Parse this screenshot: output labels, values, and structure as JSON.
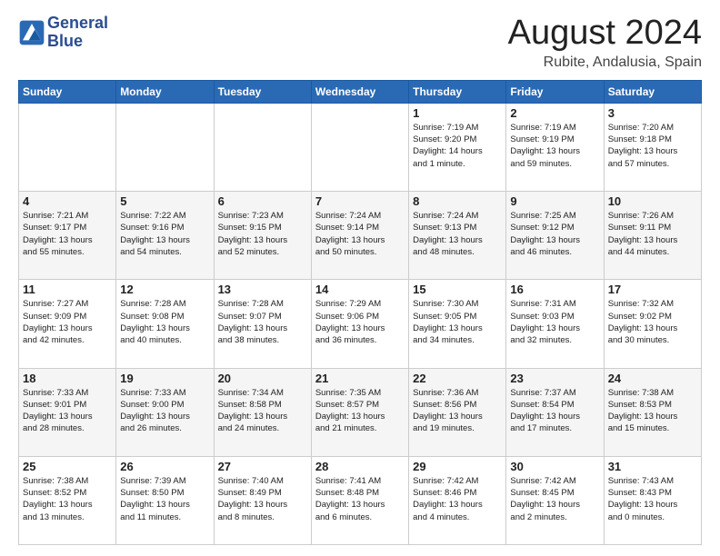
{
  "logo": {
    "line1": "General",
    "line2": "Blue"
  },
  "title": "August 2024",
  "location": "Rubite, Andalusia, Spain",
  "header_days": [
    "Sunday",
    "Monday",
    "Tuesday",
    "Wednesday",
    "Thursday",
    "Friday",
    "Saturday"
  ],
  "weeks": [
    [
      {
        "day": "",
        "info": ""
      },
      {
        "day": "",
        "info": ""
      },
      {
        "day": "",
        "info": ""
      },
      {
        "day": "",
        "info": ""
      },
      {
        "day": "1",
        "info": "Sunrise: 7:19 AM\nSunset: 9:20 PM\nDaylight: 14 hours\nand 1 minute."
      },
      {
        "day": "2",
        "info": "Sunrise: 7:19 AM\nSunset: 9:19 PM\nDaylight: 13 hours\nand 59 minutes."
      },
      {
        "day": "3",
        "info": "Sunrise: 7:20 AM\nSunset: 9:18 PM\nDaylight: 13 hours\nand 57 minutes."
      }
    ],
    [
      {
        "day": "4",
        "info": "Sunrise: 7:21 AM\nSunset: 9:17 PM\nDaylight: 13 hours\nand 55 minutes."
      },
      {
        "day": "5",
        "info": "Sunrise: 7:22 AM\nSunset: 9:16 PM\nDaylight: 13 hours\nand 54 minutes."
      },
      {
        "day": "6",
        "info": "Sunrise: 7:23 AM\nSunset: 9:15 PM\nDaylight: 13 hours\nand 52 minutes."
      },
      {
        "day": "7",
        "info": "Sunrise: 7:24 AM\nSunset: 9:14 PM\nDaylight: 13 hours\nand 50 minutes."
      },
      {
        "day": "8",
        "info": "Sunrise: 7:24 AM\nSunset: 9:13 PM\nDaylight: 13 hours\nand 48 minutes."
      },
      {
        "day": "9",
        "info": "Sunrise: 7:25 AM\nSunset: 9:12 PM\nDaylight: 13 hours\nand 46 minutes."
      },
      {
        "day": "10",
        "info": "Sunrise: 7:26 AM\nSunset: 9:11 PM\nDaylight: 13 hours\nand 44 minutes."
      }
    ],
    [
      {
        "day": "11",
        "info": "Sunrise: 7:27 AM\nSunset: 9:09 PM\nDaylight: 13 hours\nand 42 minutes."
      },
      {
        "day": "12",
        "info": "Sunrise: 7:28 AM\nSunset: 9:08 PM\nDaylight: 13 hours\nand 40 minutes."
      },
      {
        "day": "13",
        "info": "Sunrise: 7:28 AM\nSunset: 9:07 PM\nDaylight: 13 hours\nand 38 minutes."
      },
      {
        "day": "14",
        "info": "Sunrise: 7:29 AM\nSunset: 9:06 PM\nDaylight: 13 hours\nand 36 minutes."
      },
      {
        "day": "15",
        "info": "Sunrise: 7:30 AM\nSunset: 9:05 PM\nDaylight: 13 hours\nand 34 minutes."
      },
      {
        "day": "16",
        "info": "Sunrise: 7:31 AM\nSunset: 9:03 PM\nDaylight: 13 hours\nand 32 minutes."
      },
      {
        "day": "17",
        "info": "Sunrise: 7:32 AM\nSunset: 9:02 PM\nDaylight: 13 hours\nand 30 minutes."
      }
    ],
    [
      {
        "day": "18",
        "info": "Sunrise: 7:33 AM\nSunset: 9:01 PM\nDaylight: 13 hours\nand 28 minutes."
      },
      {
        "day": "19",
        "info": "Sunrise: 7:33 AM\nSunset: 9:00 PM\nDaylight: 13 hours\nand 26 minutes."
      },
      {
        "day": "20",
        "info": "Sunrise: 7:34 AM\nSunset: 8:58 PM\nDaylight: 13 hours\nand 24 minutes."
      },
      {
        "day": "21",
        "info": "Sunrise: 7:35 AM\nSunset: 8:57 PM\nDaylight: 13 hours\nand 21 minutes."
      },
      {
        "day": "22",
        "info": "Sunrise: 7:36 AM\nSunset: 8:56 PM\nDaylight: 13 hours\nand 19 minutes."
      },
      {
        "day": "23",
        "info": "Sunrise: 7:37 AM\nSunset: 8:54 PM\nDaylight: 13 hours\nand 17 minutes."
      },
      {
        "day": "24",
        "info": "Sunrise: 7:38 AM\nSunset: 8:53 PM\nDaylight: 13 hours\nand 15 minutes."
      }
    ],
    [
      {
        "day": "25",
        "info": "Sunrise: 7:38 AM\nSunset: 8:52 PM\nDaylight: 13 hours\nand 13 minutes."
      },
      {
        "day": "26",
        "info": "Sunrise: 7:39 AM\nSunset: 8:50 PM\nDaylight: 13 hours\nand 11 minutes."
      },
      {
        "day": "27",
        "info": "Sunrise: 7:40 AM\nSunset: 8:49 PM\nDaylight: 13 hours\nand 8 minutes."
      },
      {
        "day": "28",
        "info": "Sunrise: 7:41 AM\nSunset: 8:48 PM\nDaylight: 13 hours\nand 6 minutes."
      },
      {
        "day": "29",
        "info": "Sunrise: 7:42 AM\nSunset: 8:46 PM\nDaylight: 13 hours\nand 4 minutes."
      },
      {
        "day": "30",
        "info": "Sunrise: 7:42 AM\nSunset: 8:45 PM\nDaylight: 13 hours\nand 2 minutes."
      },
      {
        "day": "31",
        "info": "Sunrise: 7:43 AM\nSunset: 8:43 PM\nDaylight: 13 hours\nand 0 minutes."
      }
    ]
  ]
}
